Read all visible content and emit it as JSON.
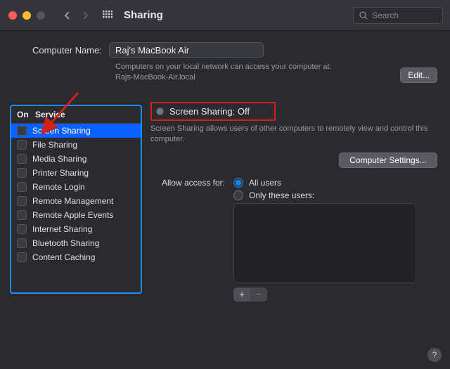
{
  "window": {
    "title": "Sharing",
    "search_placeholder": "Search"
  },
  "computer_name": {
    "label": "Computer Name:",
    "value": "Raj's MacBook Air",
    "info_line1": "Computers on your local network can access your computer at:",
    "info_line2": "Rajs-MacBook-Air.local",
    "edit_label": "Edit..."
  },
  "services": {
    "col_on": "On",
    "col_service": "Service",
    "items": [
      {
        "label": "Screen Sharing",
        "on": false,
        "selected": true
      },
      {
        "label": "File Sharing",
        "on": false,
        "selected": false
      },
      {
        "label": "Media Sharing",
        "on": false,
        "selected": false
      },
      {
        "label": "Printer Sharing",
        "on": false,
        "selected": false
      },
      {
        "label": "Remote Login",
        "on": false,
        "selected": false
      },
      {
        "label": "Remote Management",
        "on": false,
        "selected": false
      },
      {
        "label": "Remote Apple Events",
        "on": false,
        "selected": false
      },
      {
        "label": "Internet Sharing",
        "on": false,
        "selected": false
      },
      {
        "label": "Bluetooth Sharing",
        "on": false,
        "selected": false
      },
      {
        "label": "Content Caching",
        "on": false,
        "selected": false
      }
    ]
  },
  "detail": {
    "status_title": "Screen Sharing: Off",
    "description": "Screen Sharing allows users of other computers to remotely view and control this computer.",
    "computer_settings_label": "Computer Settings...",
    "access_label": "Allow access for:",
    "radio_all": "All users",
    "radio_only": "Only these users:",
    "selected_radio": "all",
    "add_label": "+",
    "remove_label": "−"
  },
  "help": "?",
  "annotations": {
    "arrow_color": "#d0211c",
    "status_highlight_color": "#d0211c",
    "sidebar_highlight_color": "#1a8cff"
  }
}
